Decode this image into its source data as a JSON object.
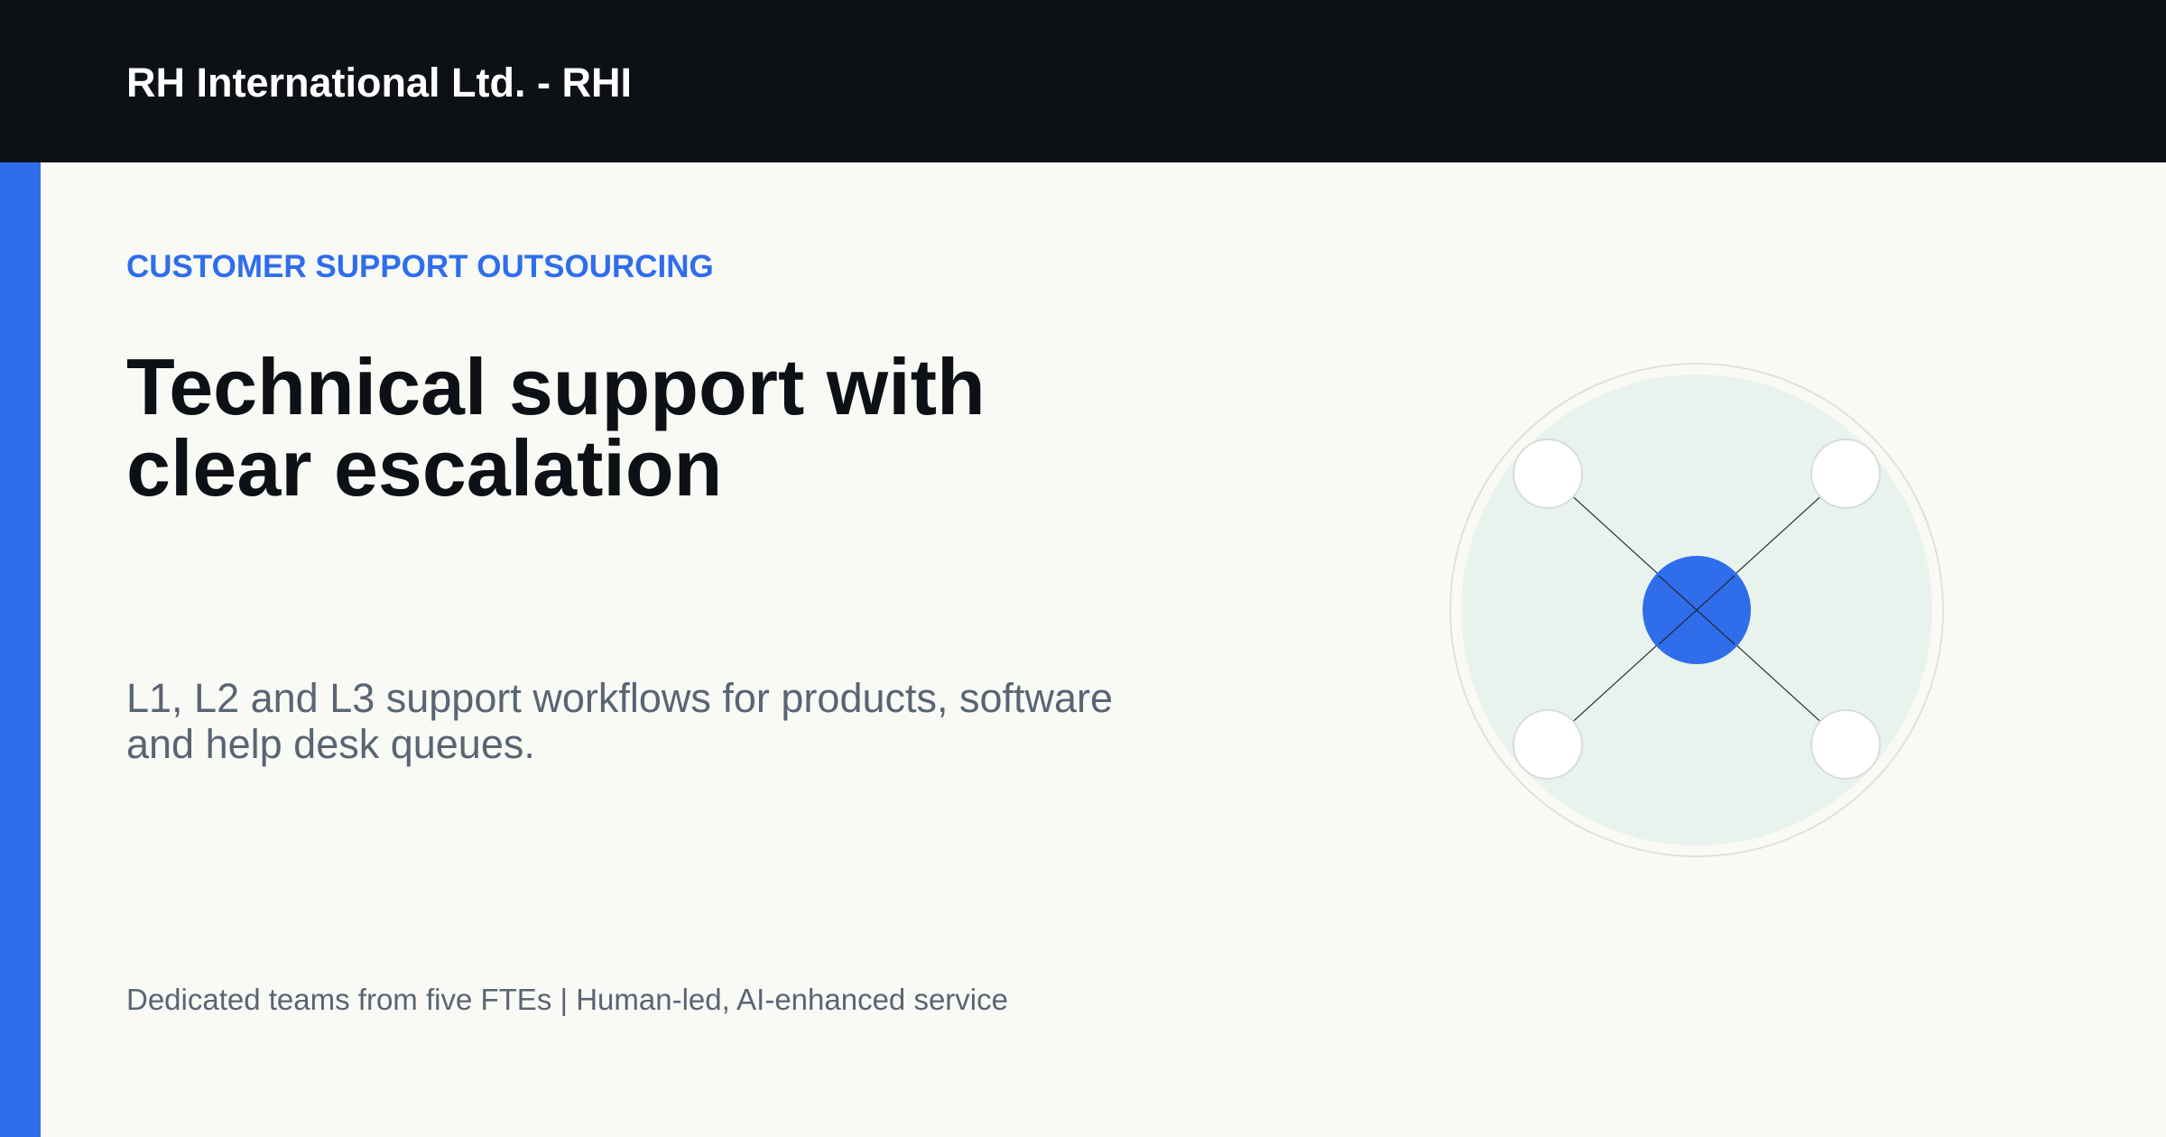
{
  "header": {
    "brand": "RH International Ltd. - RHI"
  },
  "hero": {
    "eyebrow": "CUSTOMER SUPPORT OUTSOURCING",
    "headline_line1": "Technical support with",
    "headline_line2": "clear escalation",
    "subtitle_line1": "L1, L2 and L3 support workflows for products, software",
    "subtitle_line2": "and help desk queues.",
    "footer_note": "Dedicated teams from five FTEs | Human-led, AI-enhanced service"
  },
  "colors": {
    "accent": "#2f6deb",
    "topbar": "#0d1115",
    "background": "#f9faf6",
    "diagram_fill": "#e9f3ee",
    "muted_text": "#5a6472"
  },
  "diagram": {
    "icon": "network-hub-illustration",
    "center_node": "hub",
    "outer_nodes": [
      "top-left",
      "top-right",
      "bottom-left",
      "bottom-right"
    ]
  }
}
